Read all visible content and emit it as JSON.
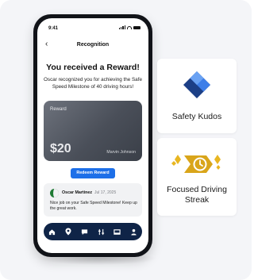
{
  "phone": {
    "status_time": "9:41",
    "nav_title": "Recognition",
    "back_glyph": "‹",
    "headline": "You received a Reward!",
    "description": "Oscar recognized you for achieving the Safe Speed Milestone of 40 driving hours!",
    "card": {
      "label": "Reward",
      "amount": "$20",
      "owner": "Marvin Johnson"
    },
    "redeem_label": "Redeem Reward",
    "comment": {
      "name": "Oscar Martinez",
      "date": "Jul 17, 2025",
      "text": "Nice job on your Safe Speed Milestone! Keep up the great work."
    },
    "tabs": [
      {
        "icon": "home-icon"
      },
      {
        "icon": "location-pin-icon"
      },
      {
        "icon": "chat-icon"
      },
      {
        "icon": "sliders-icon"
      },
      {
        "icon": "inbox-icon"
      },
      {
        "icon": "person-icon"
      }
    ]
  },
  "badges": [
    {
      "label": "Safety Kudos",
      "icon": "diamond-kudos-icon"
    },
    {
      "label": "Focused Driving Streak",
      "icon": "streak-clock-sparkle-icon"
    }
  ],
  "colors": {
    "primary_blue": "#1d6fe8",
    "tabbar_navy": "#0f2447",
    "card_gray": "#4a4f59",
    "gold": "#e8b621"
  }
}
